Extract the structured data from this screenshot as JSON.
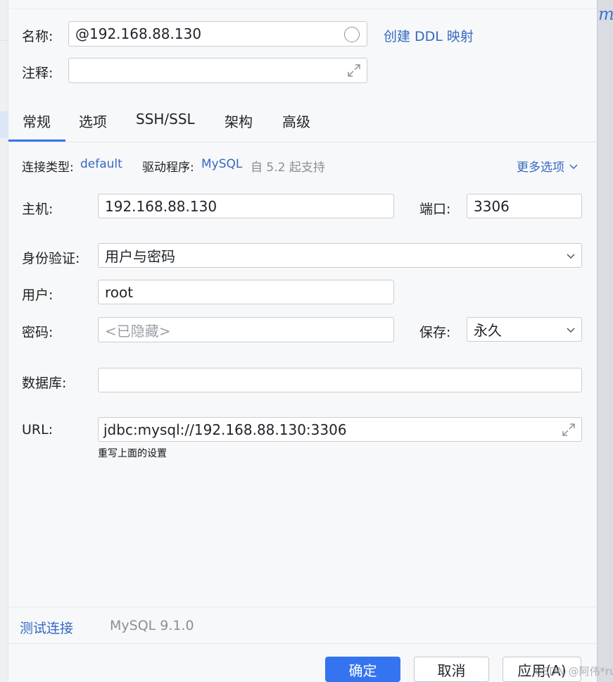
{
  "header": {
    "name_label": "名称:",
    "name_value": "@192.168.88.130",
    "create_ddl_link": "创建 DDL 映射",
    "comment_label": "注释:",
    "comment_value": ""
  },
  "tabs": [
    {
      "label": "常规",
      "active": true
    },
    {
      "label": "选项",
      "active": false
    },
    {
      "label": "SSH/SSL",
      "active": false
    },
    {
      "label": "架构",
      "active": false
    },
    {
      "label": "高级",
      "active": false
    }
  ],
  "info": {
    "conn_type_label": "连接类型:",
    "conn_type_value": "default",
    "driver_label": "驱动程序:",
    "driver_value": "MySQL",
    "driver_note": "自 5.2 起支持",
    "more_options": "更多选项"
  },
  "form": {
    "host_label": "主机:",
    "host_value": "192.168.88.130",
    "port_label": "端口:",
    "port_value": "3306",
    "auth_label": "身份验证:",
    "auth_value": "用户与密码",
    "user_label": "用户:",
    "user_value": "root",
    "password_label": "密码:",
    "password_placeholder": "<已隐藏>",
    "save_label": "保存:",
    "save_value": "永久",
    "database_label": "数据库:",
    "database_value": "",
    "url_label": "URL:",
    "url_value": "jdbc:mysql://192.168.88.130:3306",
    "url_hint": "重写上面的设置"
  },
  "footer": {
    "test_connection": "测试连接",
    "driver_version": "MySQL 9.1.0"
  },
  "buttons": {
    "ok": "确定",
    "cancel": "取消",
    "apply": "应用(A)"
  },
  "watermark": "CSDN @阿伟*rui",
  "sidebar_glyph": "m",
  "colors": {
    "accent": "#3574f0",
    "link": "#3568c2",
    "background": "#f7f8fa"
  }
}
